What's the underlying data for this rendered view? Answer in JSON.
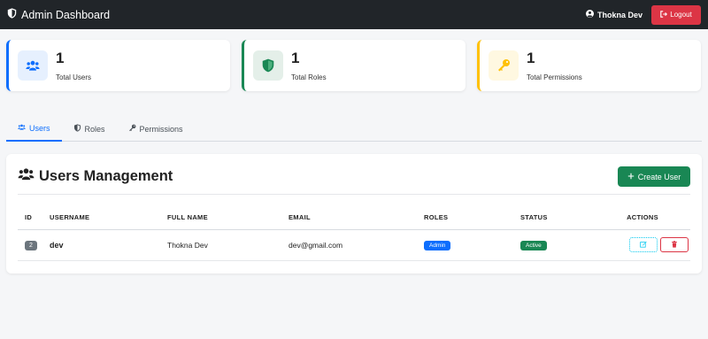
{
  "navbar": {
    "brand": "Admin Dashboard",
    "user_name": "Thokna Dev",
    "logout_label": "Logout"
  },
  "stats": [
    {
      "value": "1",
      "label": "Total Users",
      "icon": "users-icon",
      "color": "#0d6efd"
    },
    {
      "value": "1",
      "label": "Total Roles",
      "icon": "shield-icon",
      "color": "#198754"
    },
    {
      "value": "1",
      "label": "Total Permissions",
      "icon": "key-icon",
      "color": "#ffc107"
    }
  ],
  "tabs": [
    {
      "label": "Users",
      "active": true
    },
    {
      "label": "Roles",
      "active": false
    },
    {
      "label": "Permissions",
      "active": false
    }
  ],
  "users_card": {
    "title": "Users Management",
    "create_label": "Create User",
    "columns": [
      "ID",
      "USERNAME",
      "FULL NAME",
      "EMAIL",
      "ROLES",
      "STATUS",
      "ACTIONS"
    ],
    "rows": [
      {
        "id": "2",
        "username": "dev",
        "full_name": "Thokna Dev",
        "email": "dev@gmail.com",
        "role": "Admin",
        "status": "Active"
      }
    ]
  },
  "colors": {
    "primary": "#0d6efd",
    "success": "#198754",
    "warning": "#ffc107",
    "danger": "#dc3545",
    "dark": "#212529"
  }
}
